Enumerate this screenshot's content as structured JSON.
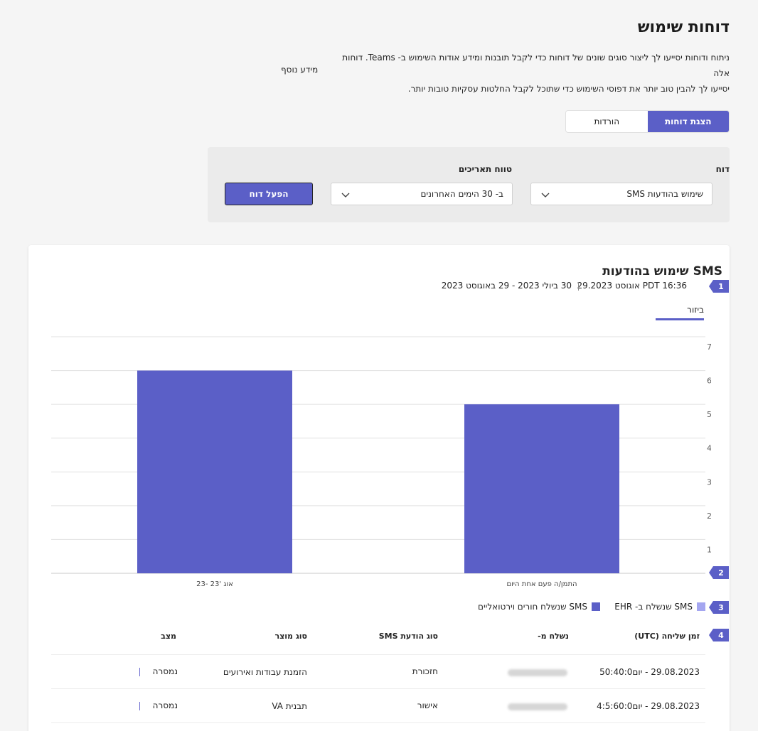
{
  "header": {
    "title": "דוחות שימוש",
    "intro_line1": "ניתוח ודוחות יסייעו לך ליצור סוגים שונים של דוחות כדי לקבל תובנות ומידע אודות השימוש ב- Teams. דוחות אלה",
    "intro_line2": "יסייעו לך להבין טוב יותר את דפוסי השימוש כדי שתוכל לקבל החלטות עסקיות טובות יותר.",
    "learn_more": "מידע נוסף"
  },
  "tabs": [
    {
      "label": "הצגת דוחות",
      "active": true
    },
    {
      "label": "הורדות",
      "active": false
    }
  ],
  "filters": {
    "report_label": "דוח",
    "report_value": "שימוש בהודעות SMS",
    "range_label": "טווח תאריכים",
    "range_value": "ב- 30 הימים האחרונים",
    "run_button": "הפעל דוח"
  },
  "report": {
    "title": "שימוש בהודעות SMS",
    "generated": "אוגוסט 29.2023 PDT 16:36",
    "period": "30 ביולי 2023 - 29 באוגוסט 2023",
    "view_tab": "ביזור"
  },
  "markers": [
    "1",
    "2",
    "3",
    "4"
  ],
  "chart_data": {
    "type": "bar",
    "categories": [
      "אוג '23 -23",
      "התמן/ה פעם אחת היום"
    ],
    "values": [
      6,
      5
    ],
    "ylim": [
      0,
      7
    ],
    "yticks": [
      "1",
      "2",
      "3",
      "4",
      "5",
      "6",
      "7"
    ],
    "grid": true,
    "bar_color": "#5b5fc7"
  },
  "legend": [
    {
      "label": "SMS שנשלח ב- EHR",
      "color": "#a4a6f0"
    },
    {
      "label": "SMS שנשלח חורים וירטואליים",
      "color": "#5b5fc7"
    }
  ],
  "table": {
    "headers": [
      "זמן שליחה (UTC)",
      "נשלח מ-",
      "סוג הודעת SMS",
      "סוג מוצר",
      "מצב"
    ],
    "rows": [
      [
        "29.08.2023 - יום50:40:0",
        "חזכורת",
        "הזמנת עבודות ואירועים",
        "נמסרה"
      ],
      [
        "29.08.2023 - יום4:5:60:0",
        "אישור",
        "תבנית VA",
        "נמסרה"
      ]
    ]
  }
}
